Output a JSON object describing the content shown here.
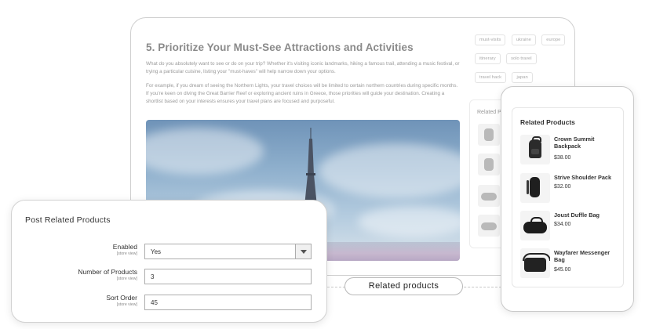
{
  "blog": {
    "title": "5. Prioritize Your Must-See Attractions and Activities",
    "paragraph1": "What do you absolutely want to see or do on your trip? Whether it's visiting iconic landmarks, hiking a famous trail, attending a music festival, or trying a particular cuisine, listing your \"must-haves\" will help narrow down your options.",
    "paragraph2": "For example, if you dream of seeing the Northern Lights, your travel choices will be limited to certain northern countries during specific months. If you're keen on diving the Great Barrier Reef or exploring ancient ruins in Greece, those priorities will guide your destination. Creating a shortlist based on your interests ensures your travel plans are focused and purposeful.",
    "tags": [
      "must-visits",
      "ukraine",
      "europe",
      "itinerary",
      "solo travel",
      "travel hack",
      "japan"
    ],
    "related_heading": "Related P"
  },
  "admin": {
    "title": "Post Related Products",
    "fields": [
      {
        "label": "Enabled",
        "scope": "[store view]",
        "value": "Yes"
      },
      {
        "label": "Number of Products",
        "scope": "[store view]",
        "value": "3"
      },
      {
        "label": "Sort Order",
        "scope": "[store view]",
        "value": "45"
      }
    ]
  },
  "connector": {
    "label": "Related  products"
  },
  "mobile": {
    "heading": "Related Products",
    "products": [
      {
        "name": "Crown Summit Backpack",
        "price": "$38.00",
        "icon": "backpack-icon"
      },
      {
        "name": "Strive Shoulder Pack",
        "price": "$32.00",
        "icon": "shoulder-pack-icon"
      },
      {
        "name": "Joust Duffle Bag",
        "price": "$34.00",
        "icon": "duffle-bag-icon"
      },
      {
        "name": "Wayfarer Messenger Bag",
        "price": "$45.00",
        "icon": "messenger-bag-icon"
      }
    ]
  },
  "colors": {
    "accent": "#333333",
    "muted": "#8a8a8a",
    "border": "#cfcfcf"
  }
}
